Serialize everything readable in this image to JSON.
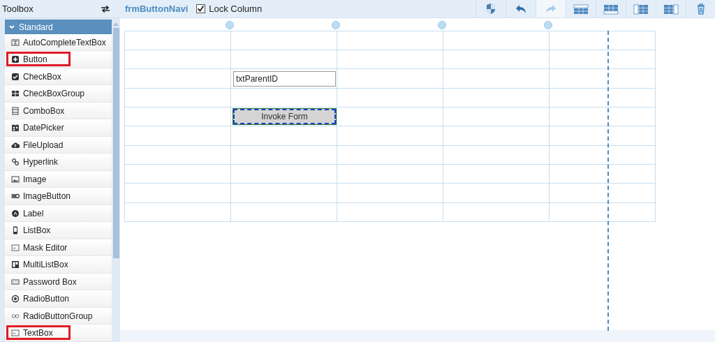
{
  "sidebar": {
    "title": "Toolbox",
    "group": {
      "label": "Standard",
      "expanded": true,
      "items": [
        {
          "label": "AutoCompleteTextBox",
          "kind": "autocomplete",
          "highlighted": false
        },
        {
          "label": "Button",
          "kind": "button",
          "highlighted": true
        },
        {
          "label": "CheckBox",
          "kind": "checkbox",
          "highlighted": false
        },
        {
          "label": "CheckBoxGroup",
          "kind": "checkboxgroup",
          "highlighted": false
        },
        {
          "label": "ComboBox",
          "kind": "combobox",
          "highlighted": false
        },
        {
          "label": "DatePicker",
          "kind": "datepicker",
          "highlighted": false
        },
        {
          "label": "FileUpload",
          "kind": "fileupload",
          "highlighted": false
        },
        {
          "label": "Hyperlink",
          "kind": "hyperlink",
          "highlighted": false
        },
        {
          "label": "Image",
          "kind": "image",
          "highlighted": false
        },
        {
          "label": "ImageButton",
          "kind": "imagebutton",
          "highlighted": false
        },
        {
          "label": "Label",
          "kind": "label",
          "highlighted": false
        },
        {
          "label": "ListBox",
          "kind": "listbox",
          "highlighted": false
        },
        {
          "label": "Mask Editor",
          "kind": "textbox",
          "highlighted": false
        },
        {
          "label": "MultiListBox",
          "kind": "multilistbox",
          "highlighted": false
        },
        {
          "label": "Password Box",
          "kind": "password",
          "highlighted": false
        },
        {
          "label": "RadioButton",
          "kind": "radio",
          "highlighted": false
        },
        {
          "label": "RadioButtonGroup",
          "kind": "radiogroup",
          "highlighted": false
        },
        {
          "label": "TextBox",
          "kind": "textbox",
          "highlighted": true
        }
      ]
    }
  },
  "header": {
    "form_name": "frmButtonNavi",
    "lock_column": {
      "label": "Lock Column",
      "checked": true
    }
  },
  "toolbar": [
    {
      "kind": "shield",
      "disabled": false
    },
    {
      "kind": "undo",
      "disabled": false
    },
    {
      "kind": "redo",
      "disabled": true
    },
    {
      "kind": "insert-row-above",
      "disabled": false
    },
    {
      "kind": "insert-row-below",
      "disabled": false
    },
    {
      "kind": "insert-column-left",
      "disabled": false
    },
    {
      "kind": "insert-column-right",
      "disabled": false
    },
    {
      "kind": "delete",
      "disabled": false
    }
  ],
  "grid": {
    "rows": [
      {
        "cells": [
          {
            "kind": "empty"
          },
          {
            "kind": "empty"
          },
          {
            "kind": "empty"
          },
          {
            "kind": "empty"
          },
          {
            "kind": "empty"
          }
        ]
      },
      {
        "cells": [
          {
            "kind": "empty"
          },
          {
            "kind": "empty"
          },
          {
            "kind": "empty"
          },
          {
            "kind": "empty"
          },
          {
            "kind": "empty"
          }
        ]
      },
      {
        "cells": [
          {
            "kind": "empty"
          },
          {
            "kind": "textbox",
            "text": "txtParentID"
          },
          {
            "kind": "empty"
          },
          {
            "kind": "empty"
          },
          {
            "kind": "empty"
          }
        ]
      },
      {
        "cells": [
          {
            "kind": "empty"
          },
          {
            "kind": "empty"
          },
          {
            "kind": "empty"
          },
          {
            "kind": "empty"
          },
          {
            "kind": "empty"
          }
        ]
      },
      {
        "cells": [
          {
            "kind": "empty"
          },
          {
            "kind": "button",
            "text": "Invoke Form",
            "selected": true
          },
          {
            "kind": "empty"
          },
          {
            "kind": "empty"
          },
          {
            "kind": "empty"
          }
        ]
      },
      {
        "cells": [
          {
            "kind": "empty"
          },
          {
            "kind": "empty"
          },
          {
            "kind": "empty"
          },
          {
            "kind": "empty"
          },
          {
            "kind": "empty"
          }
        ]
      },
      {
        "cells": [
          {
            "kind": "empty"
          },
          {
            "kind": "empty"
          },
          {
            "kind": "empty"
          },
          {
            "kind": "empty"
          },
          {
            "kind": "empty"
          }
        ]
      },
      {
        "cells": [
          {
            "kind": "empty"
          },
          {
            "kind": "empty"
          },
          {
            "kind": "empty"
          },
          {
            "kind": "empty"
          },
          {
            "kind": "empty"
          }
        ]
      },
      {
        "cells": [
          {
            "kind": "empty"
          },
          {
            "kind": "empty"
          },
          {
            "kind": "empty"
          },
          {
            "kind": "empty"
          },
          {
            "kind": "empty"
          }
        ]
      },
      {
        "cells": [
          {
            "kind": "empty"
          },
          {
            "kind": "empty"
          },
          {
            "kind": "empty"
          },
          {
            "kind": "empty"
          },
          {
            "kind": "empty"
          }
        ]
      }
    ]
  }
}
